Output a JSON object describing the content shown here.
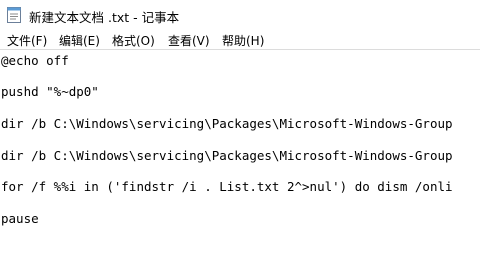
{
  "window": {
    "title": "新建文本文档 .txt - 记事本",
    "icon": "notepad-icon"
  },
  "menu": {
    "items": [
      {
        "label": "文件(F)"
      },
      {
        "label": "编辑(E)"
      },
      {
        "label": "格式(O)"
      },
      {
        "label": "查看(V)"
      },
      {
        "label": "帮助(H)"
      }
    ]
  },
  "editor": {
    "lines": [
      "@echo off",
      "pushd \"%~dp0\"",
      "dir /b C:\\Windows\\servicing\\Packages\\Microsoft-Windows-Group",
      "dir /b C:\\Windows\\servicing\\Packages\\Microsoft-Windows-Group",
      "for /f %%i in ('findstr /i . List.txt 2^>nul') do dism /onli",
      "pause"
    ]
  }
}
